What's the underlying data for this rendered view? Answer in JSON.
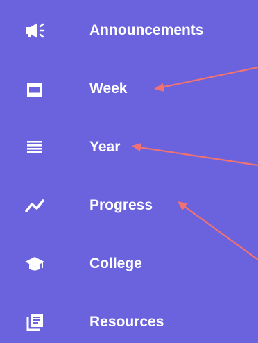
{
  "sidebar": {
    "items": [
      {
        "label": "Announcements",
        "icon": "megaphone-icon"
      },
      {
        "label": "Week",
        "icon": "week-icon"
      },
      {
        "label": "Year",
        "icon": "year-list-icon"
      },
      {
        "label": "Progress",
        "icon": "progress-chart-icon"
      },
      {
        "label": "College",
        "icon": "graduation-cap-icon"
      },
      {
        "label": "Resources",
        "icon": "resources-icon"
      }
    ]
  },
  "colors": {
    "background": "#6b63de",
    "text": "#ffffff",
    "annotation_arrow": "#f07272"
  }
}
